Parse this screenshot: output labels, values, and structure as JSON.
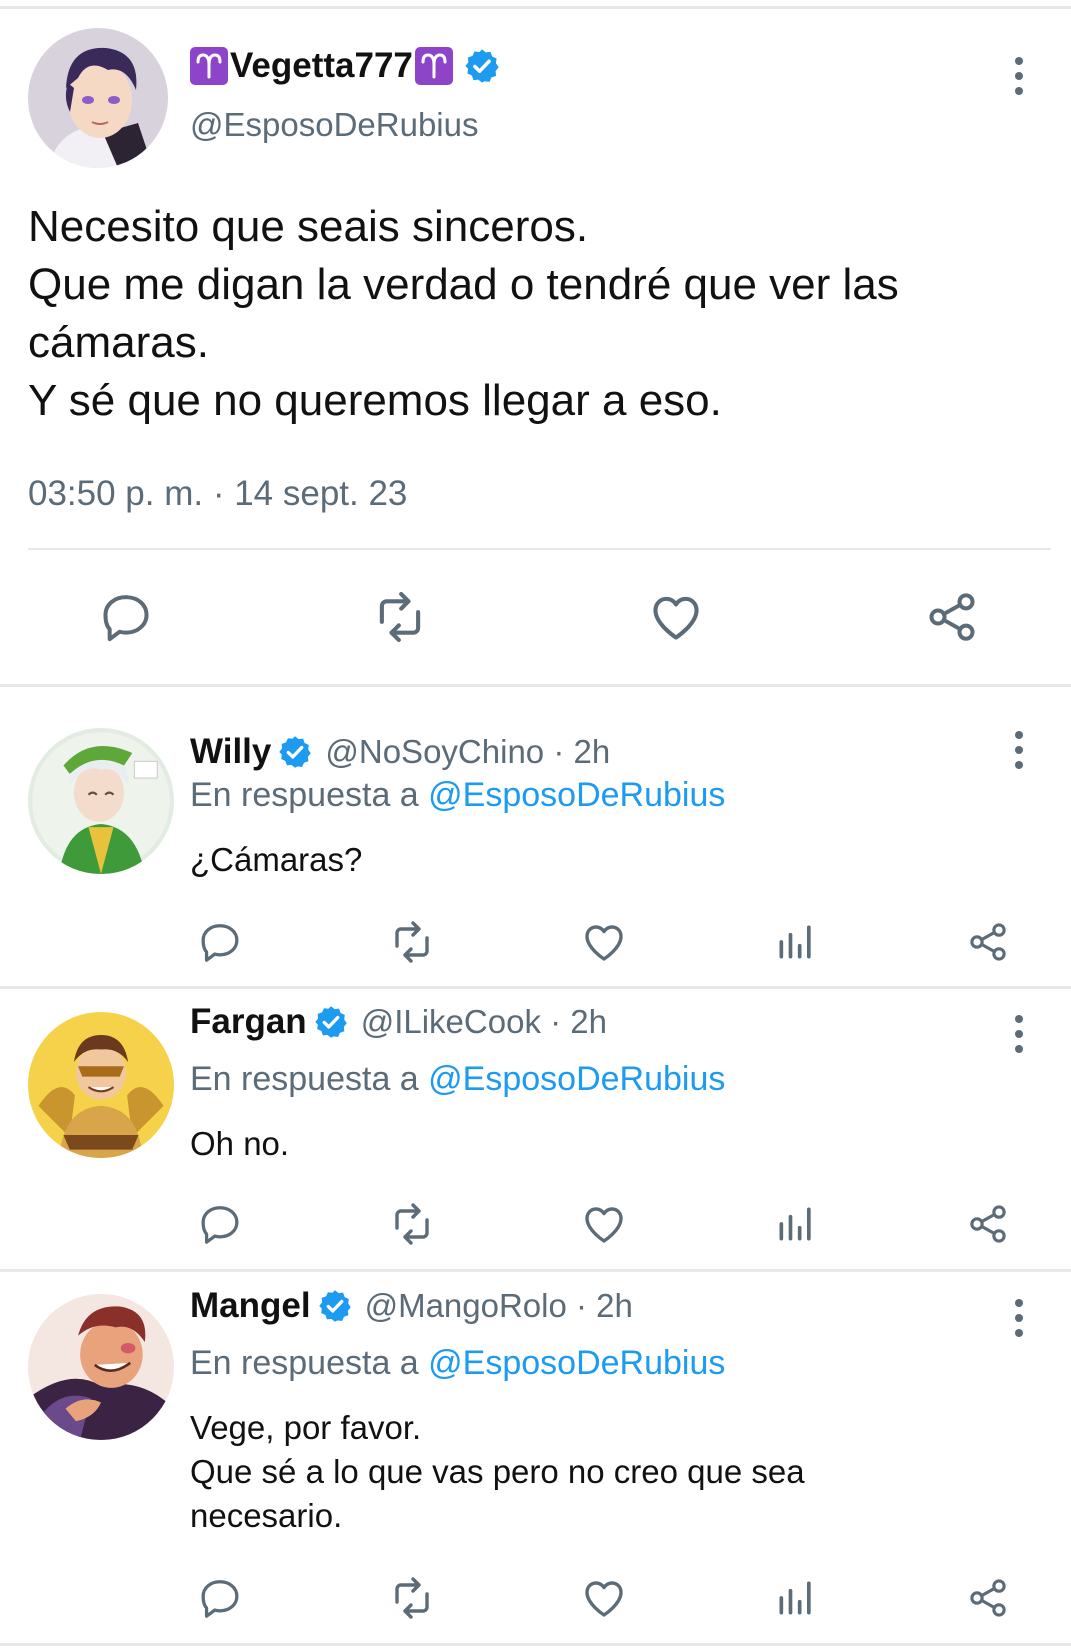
{
  "main_tweet": {
    "display_name": "Vegetta777",
    "emoji_badge": "aries",
    "handle": "@EsposoDeRubius",
    "text_lines": [
      "Necesito que seais sinceros.",
      "Que me digan la verdad o tendré que ver las",
      "cámaras.",
      "Y sé que no queremos llegar a eso."
    ],
    "timestamp": "03:50 p. m. · 14 sept. 23",
    "actions": [
      "reply-icon",
      "retweet-icon",
      "like-icon",
      "share-icon"
    ]
  },
  "replies": [
    {
      "name": "Willy",
      "handle_time": "@NoSoyChino · 2h",
      "reply_prefix": "En respuesta a",
      "reply_to": "@EsposoDeRubius",
      "text_lines": [
        "¿Cámaras?"
      ],
      "avatar_colors": {
        "bg": "#e2ece3",
        "accent": "#3f9a3a"
      }
    },
    {
      "name": "Fargan",
      "handle_time": "@ILikeCook · 2h",
      "reply_prefix": "En respuesta a",
      "reply_to": "@EsposoDeRubius",
      "text_lines": [
        "Oh no."
      ],
      "avatar_colors": {
        "bg": "#f5d24a",
        "accent": "#a86b1c"
      }
    },
    {
      "name": "Mangel",
      "handle_time": "@MangoRolo · 2h",
      "reply_prefix": "En respuesta a",
      "reply_to": "@EsposoDeRubius",
      "text_lines": [
        "Vege, por favor.",
        "Que sé a lo que vas pero no creo que sea",
        "necesario."
      ],
      "avatar_colors": {
        "bg": "#f4e6e0",
        "accent": "#3b2344"
      }
    }
  ],
  "reply_actions": [
    "reply-icon",
    "retweet-icon",
    "like-icon",
    "views-icon",
    "share-icon"
  ],
  "colors": {
    "verified": "#1d9bf0",
    "text": "#0f1419",
    "muted": "#5b6b78",
    "link": "#1d9bf0",
    "divider": "#e6e9eb",
    "aries_badge": "#8e44c9"
  }
}
